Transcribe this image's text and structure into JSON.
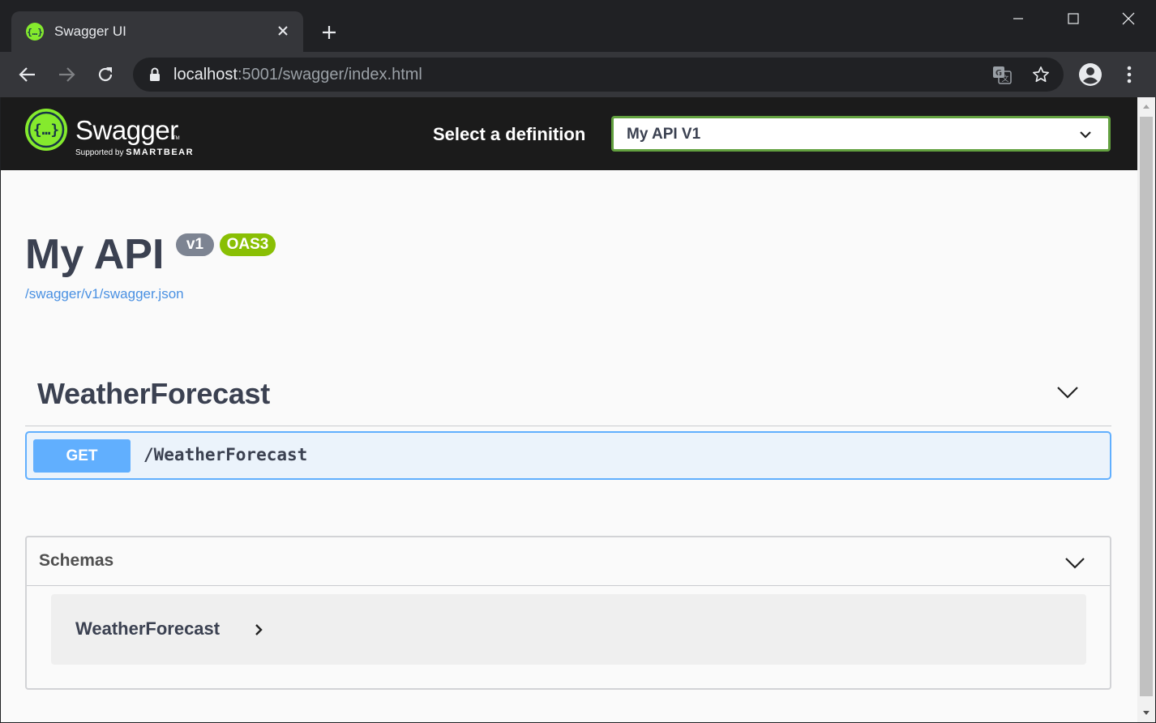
{
  "browser": {
    "tab_title": "Swagger UI",
    "url_host": "localhost",
    "url_rest": ":5001/swagger/index.html"
  },
  "topbar": {
    "logo_text": "Swagger",
    "supported_by": "Supported by",
    "brand": "SMARTBEAR",
    "definition_label": "Select a definition",
    "definition_value": "My API V1"
  },
  "info": {
    "title": "My API",
    "version_badge": "v1",
    "oas_badge": "OAS3",
    "spec_link": "/swagger/v1/swagger.json"
  },
  "tags": [
    {
      "name": "WeatherForecast",
      "operations": [
        {
          "method": "GET",
          "path": "/WeatherForecast"
        }
      ]
    }
  ],
  "schemas": {
    "title": "Schemas",
    "models": [
      "WeatherForecast"
    ]
  },
  "colors": {
    "get_blue": "#61affe",
    "oas_green": "#89bf04",
    "version_grey": "#7d8492",
    "select_border": "#62a03f",
    "topbar_bg": "#1b1b1b",
    "text": "#3b4151"
  }
}
